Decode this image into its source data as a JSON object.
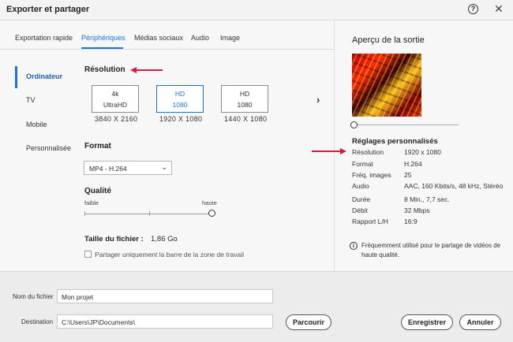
{
  "window": {
    "title": "Exporter et partager",
    "help_glyph": "?",
    "close_glyph": "✕"
  },
  "tabs": [
    {
      "label": "Exportation rapide",
      "active": false
    },
    {
      "label": "Périphériques",
      "active": true
    },
    {
      "label": "Médias sociaux",
      "active": false
    },
    {
      "label": "Audio",
      "active": false
    },
    {
      "label": "Image",
      "active": false
    }
  ],
  "sidebar": {
    "items": [
      {
        "label": "Ordinateur",
        "active": true
      },
      {
        "label": "TV",
        "active": false
      },
      {
        "label": "Mobile",
        "active": false
      },
      {
        "label": "Personnalisée",
        "active": false
      }
    ]
  },
  "resolution": {
    "label": "Résolution",
    "options": [
      {
        "line1": "4k",
        "line2": "UltraHD",
        "size": "3840 X 2160",
        "selected": false
      },
      {
        "line1": "HD",
        "line2": "1080",
        "size": "1920 X 1080",
        "selected": true
      },
      {
        "line1": "HD",
        "line2": "1080",
        "size": "1440 X 1080",
        "selected": false
      }
    ],
    "next_glyph": "›"
  },
  "format": {
    "label": "Format",
    "value": "MP4 - H.264",
    "chevron": "⌄"
  },
  "quality": {
    "label": "Qualité",
    "low": "faible",
    "high": "haute",
    "level": 1.0
  },
  "file_size": {
    "label": "Taille du fichier :",
    "value": "1,86 Go"
  },
  "share_option": {
    "label": "Partager uniquement la barre de la zone de travail",
    "checked": false
  },
  "preview": {
    "title": "Aperçu de la sortie",
    "settings_title": "Réglages personnalisés",
    "settings": [
      {
        "key": "Résolution",
        "value": "1920 x 1080"
      },
      {
        "key": "Format",
        "value": "H.264"
      },
      {
        "key": "Fréq. images",
        "value": "25"
      },
      {
        "key": "Audio",
        "value": "AAC, 160  Kbits/s, 48  kHz, Stéréo"
      },
      {
        "key": "Durée",
        "value": "8 Min., 7,7 sec."
      },
      {
        "key": "Débit",
        "value": "32 Mbps"
      },
      {
        "key": "Rapport L/H",
        "value": "16:9"
      }
    ],
    "info_glyph": "i",
    "info_line1": "Fréquemment utilisé pour le partage de vidéos de",
    "info_line2": "haute qualité."
  },
  "bottom": {
    "filename_label": "Nom du fichier",
    "filename_value": "Mon projet",
    "destination_label": "Destination",
    "destination_value": "C:\\Users\\JP\\Documents\\",
    "browse_label": "Parcourir",
    "save_label": "Enregistrer",
    "cancel_label": "Annuler"
  },
  "colors": {
    "accent": "#1473e6",
    "annotation_arrow": "#d81b3c"
  }
}
